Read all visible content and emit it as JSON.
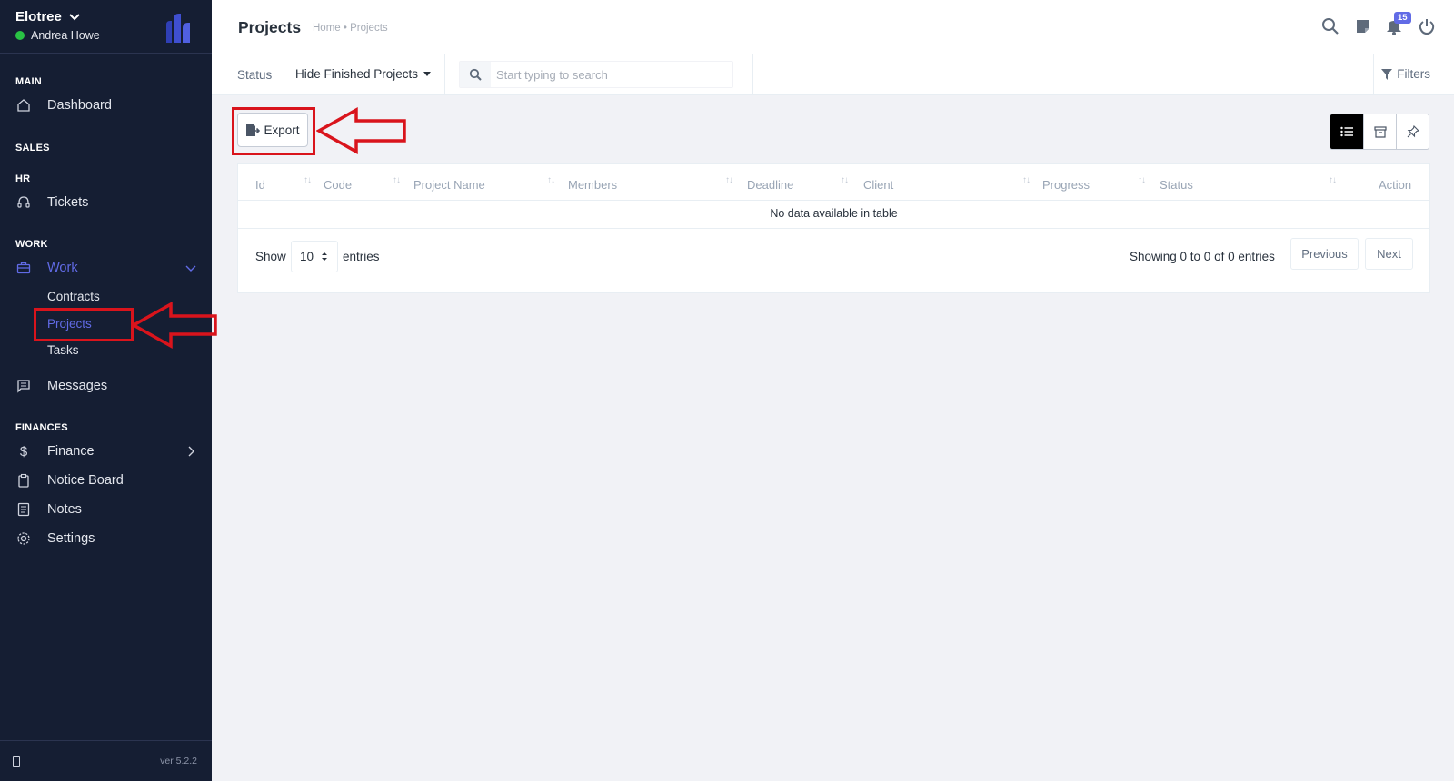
{
  "brand": {
    "name": "Elotree",
    "user": "Andrea Howe"
  },
  "sidebar": {
    "sections": {
      "main": "MAIN",
      "sales": "SALES",
      "hr": "HR",
      "work": "WORK",
      "finances": "FINANCES"
    },
    "items": {
      "dashboard": "Dashboard",
      "tickets": "Tickets",
      "work": "Work",
      "contracts": "Contracts",
      "projects": "Projects",
      "tasks": "Tasks",
      "messages": "Messages",
      "finance": "Finance",
      "notice_board": "Notice Board",
      "notes": "Notes",
      "settings": "Settings"
    },
    "version": "ver 5.2.2"
  },
  "header": {
    "title": "Projects",
    "breadcrumb": "Home • Projects",
    "notification_count": "15",
    "icons": [
      "search-icon",
      "sticky-note-icon",
      "bell-icon",
      "power-icon"
    ]
  },
  "filterbar": {
    "status_label": "Status",
    "status_value": "Hide Finished Projects",
    "search_placeholder": "Start typing to search",
    "filters_label": "Filters"
  },
  "toolbar": {
    "export_label": "Export",
    "view_icons": [
      "list-view-icon",
      "archive-icon",
      "pin-icon"
    ]
  },
  "table": {
    "columns": [
      "Id",
      "Code",
      "Project Name",
      "Members",
      "Deadline",
      "Client",
      "Progress",
      "Status",
      "Action"
    ],
    "empty_message": "No data available in table",
    "show_label": "Show",
    "page_size": "10",
    "entries_label": "entries",
    "info": "Showing 0 to 0 of 0 entries",
    "previous_label": "Previous",
    "next_label": "Next"
  },
  "colors": {
    "sidebar_bg": "#151e33",
    "accent": "#616be6",
    "annotation_red": "#d9141c",
    "online_green": "#29c244"
  }
}
